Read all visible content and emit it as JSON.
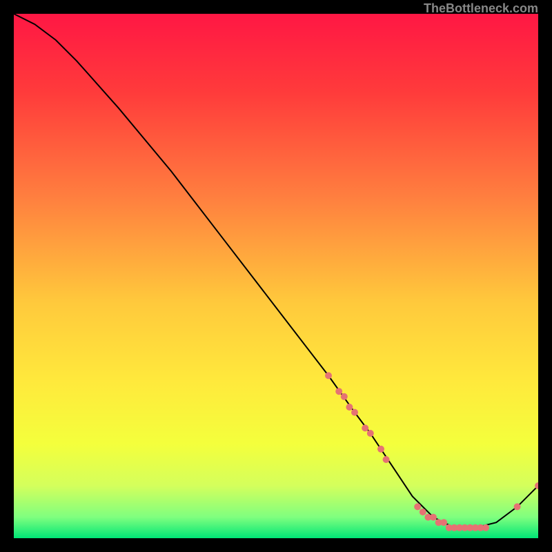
{
  "watermark": "TheBottleneck.com",
  "chart_data": {
    "type": "line",
    "title": "",
    "xlabel": "",
    "ylabel": "",
    "xlim": [
      0,
      100
    ],
    "ylim": [
      0,
      100
    ],
    "background_gradient": {
      "stops": [
        {
          "pos": 0.0,
          "color": "#ff1744"
        },
        {
          "pos": 0.15,
          "color": "#ff3b3b"
        },
        {
          "pos": 0.35,
          "color": "#ff7f3f"
        },
        {
          "pos": 0.55,
          "color": "#ffc93c"
        },
        {
          "pos": 0.7,
          "color": "#ffe93c"
        },
        {
          "pos": 0.82,
          "color": "#f4ff3c"
        },
        {
          "pos": 0.9,
          "color": "#d4ff5c"
        },
        {
          "pos": 0.96,
          "color": "#7fff7f"
        },
        {
          "pos": 1.0,
          "color": "#00e676"
        }
      ]
    },
    "series": [
      {
        "name": "bottleneck-curve",
        "type": "line",
        "color": "#000000",
        "x": [
          0,
          4,
          8,
          12,
          20,
          30,
          40,
          50,
          60,
          65,
          68,
          72,
          76,
          80,
          84,
          88,
          92,
          96,
          100
        ],
        "y": [
          100,
          98,
          95,
          91,
          82,
          70,
          57,
          44,
          31,
          24,
          20,
          14,
          8,
          4,
          2,
          2,
          3,
          6,
          10
        ]
      },
      {
        "name": "markers",
        "type": "scatter",
        "color": "#e57373",
        "x": [
          60,
          62,
          63,
          64,
          65,
          67,
          68,
          70,
          71,
          77,
          78,
          79,
          80,
          81,
          82,
          83,
          84,
          85,
          86,
          87,
          88,
          89,
          90,
          96,
          100
        ],
        "y": [
          31,
          28,
          27,
          25,
          24,
          21,
          20,
          17,
          15,
          6,
          5,
          4,
          4,
          3,
          3,
          2,
          2,
          2,
          2,
          2,
          2,
          2,
          2,
          6,
          10
        ]
      }
    ]
  }
}
